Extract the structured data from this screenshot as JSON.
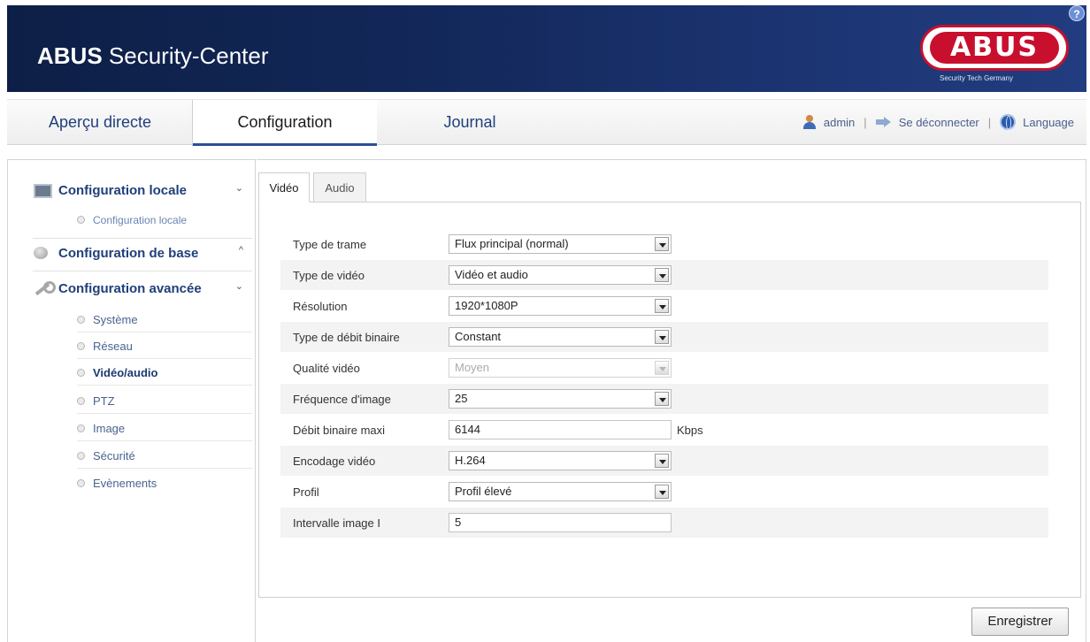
{
  "header": {
    "title_bold": "ABUS",
    "title_rest": " Security-Center",
    "logo_text": "ABUS",
    "logo_tagline": "Security Tech Germany",
    "help_label": "?"
  },
  "nav": {
    "tabs": [
      {
        "label": "Aperçu directe"
      },
      {
        "label": "Configuration"
      },
      {
        "label": "Journal"
      }
    ],
    "active_tab": "Configuration",
    "user": "admin",
    "logout": "Se déconnecter",
    "language": "Language",
    "separator": "|"
  },
  "sidebar": {
    "sections": [
      {
        "label": "Configuration locale",
        "chevron": "⌄"
      },
      {
        "label": "Configuration de base",
        "chevron": "^"
      },
      {
        "label": "Configuration avancée",
        "chevron": "⌄"
      }
    ],
    "local_items": [
      "Configuration locale"
    ],
    "advanced_items": [
      "Système",
      "Réseau",
      "Vidéo/audio",
      "PTZ",
      "Image",
      "Sécurité",
      "Evènements"
    ],
    "active_item": "Vidéo/audio"
  },
  "subtabs": [
    {
      "label": "Vidéo"
    },
    {
      "label": "Audio"
    }
  ],
  "form": {
    "rows": [
      {
        "label": "Type de trame",
        "value": "Flux principal (normal)"
      },
      {
        "label": "Type de vidéo",
        "value": "Vidéo et audio"
      },
      {
        "label": "Résolution",
        "value": "1920*1080P"
      },
      {
        "label": "Type de débit binaire",
        "value": "Constant"
      },
      {
        "label": "Qualité vidéo",
        "value": "Moyen"
      },
      {
        "label": "Fréquence d'image",
        "value": "25"
      },
      {
        "label": "Débit binaire maxi",
        "value": "6144",
        "unit": "Kbps"
      },
      {
        "label": "Encodage vidéo",
        "value": "H.264"
      },
      {
        "label": "Profil",
        "value": "Profil élevé"
      },
      {
        "label": "Intervalle image I",
        "value": "5"
      }
    ]
  },
  "save_label": "Enregistrer"
}
